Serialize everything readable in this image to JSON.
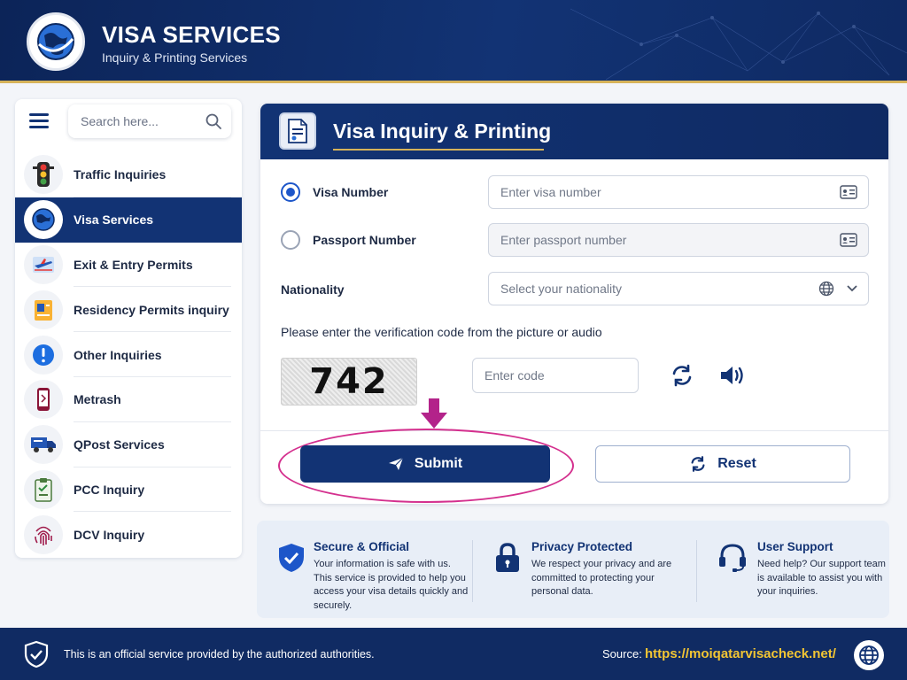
{
  "header": {
    "title": "VISA SERVICES",
    "subtitle": "Inquiry & Printing Services",
    "logo_icon": "globe-logo-icon"
  },
  "sidebar": {
    "menu_icon": "hamburger-icon",
    "search": {
      "placeholder": "Search here...",
      "value": ""
    },
    "items": [
      {
        "label": "Traffic Inquiries",
        "icon": "traffic-light-icon",
        "active": false
      },
      {
        "label": "Visa Services",
        "icon": "globe-logo-icon",
        "active": true
      },
      {
        "label": "Exit & Entry Permits",
        "icon": "airplane-icon",
        "active": false
      },
      {
        "label": "Residency Permits inquiry",
        "icon": "id-card-icon",
        "active": false
      },
      {
        "label": "Other Inquiries",
        "icon": "info-icon",
        "active": false
      },
      {
        "label": "Metrash",
        "icon": "phone-icon",
        "active": false
      },
      {
        "label": "QPost Services",
        "icon": "truck-icon",
        "active": false
      },
      {
        "label": "PCC Inquiry",
        "icon": "clipboard-icon",
        "active": false
      },
      {
        "label": "DCV Inquiry",
        "icon": "fingerprint-icon",
        "active": false
      }
    ]
  },
  "form": {
    "title": "Visa Inquiry & Printing",
    "visa_number": {
      "label": "Visa Number",
      "placeholder": "Enter visa number",
      "selected": true
    },
    "passport_number": {
      "label": "Passport Number",
      "placeholder": "Enter passport number",
      "selected": false
    },
    "nationality": {
      "label": "Nationality",
      "placeholder": "Select your nationality"
    },
    "verification_text": "Please enter the verification code from the picture or audio",
    "captcha_code": "742",
    "code_placeholder": "Enter code",
    "submit_label": "Submit",
    "reset_label": "Reset"
  },
  "info": [
    {
      "title": "Secure & Official",
      "icon": "shield-check-icon",
      "body": "Your information is safe with us. This service is provided to help you access your visa details quickly and securely."
    },
    {
      "title": "Privacy Protected",
      "icon": "lock-icon",
      "body": "We respect your privacy and are committed to protecting your personal data."
    },
    {
      "title": "User Support",
      "icon": "headset-icon",
      "body": "Need help? Our support team is available to assist you with your inquiries."
    }
  ],
  "footer": {
    "notice": "This is an official service provided by the authorized authorities.",
    "source_label": "Source:",
    "source_url": "https://moiqatarvisacheck.net/"
  },
  "colors": {
    "navy": "#123374",
    "gold": "#d6b35a",
    "highlight": "#d4308e",
    "link": "#f2c533"
  }
}
